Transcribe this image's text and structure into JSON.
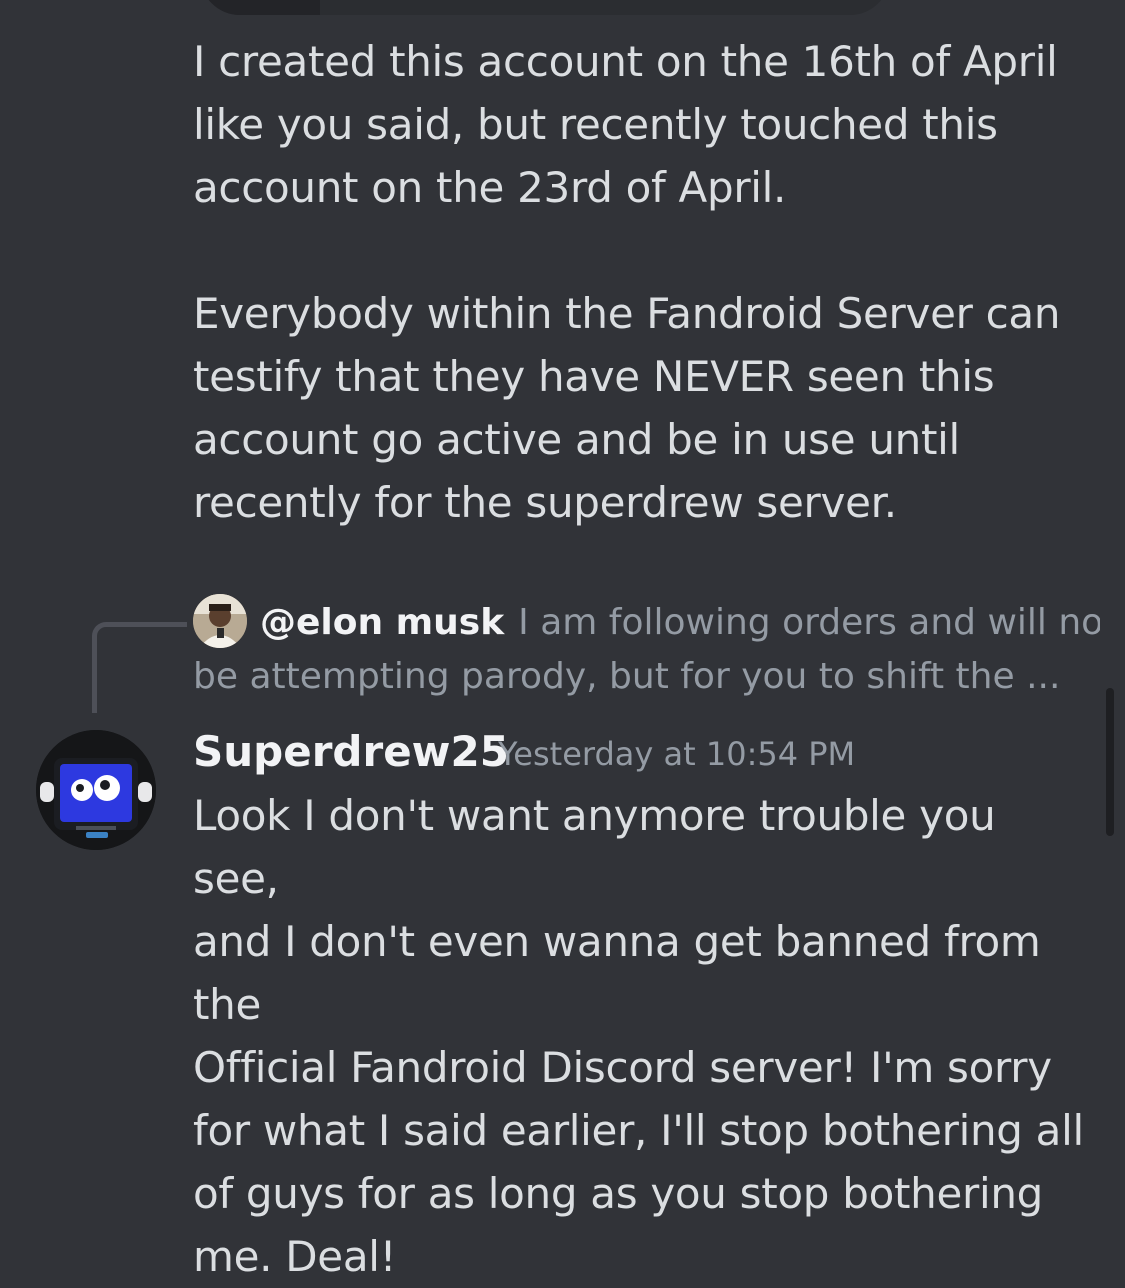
{
  "messages": {
    "previous": {
      "paragraph1": "I created this account on the 16th of April\nlike you said, but recently touched this\naccount on the 23rd of April.",
      "paragraph2": "Everybody within the Fandroid Server can\ntestify that they have NEVER seen this\naccount go active and be in use until\nrecently for the superdrew server."
    },
    "reply": {
      "author": "@elon musk",
      "snippet_line1": "I am following orders and will not",
      "snippet_line2": "be attempting parody, but for you to shift the ..."
    },
    "current": {
      "author": "Superdrew25",
      "timestamp": "Yesterday at 10:54 PM",
      "content": "Look I don't want anymore trouble you see,\nand I don't even wanna get banned from the\nOfficial Fandroid Discord server! I'm sorry\nfor what I said earlier, I'll stop bothering all\nof guys for as long as you stop bothering\nme. Deal!"
    }
  },
  "colors": {
    "background": "#313338",
    "text": "#dbdee1",
    "muted": "#949ba4",
    "author": "#f2f3f5"
  },
  "icons": {
    "reply_avatar": "person-avatar",
    "author_avatar": "robot-avatar"
  }
}
